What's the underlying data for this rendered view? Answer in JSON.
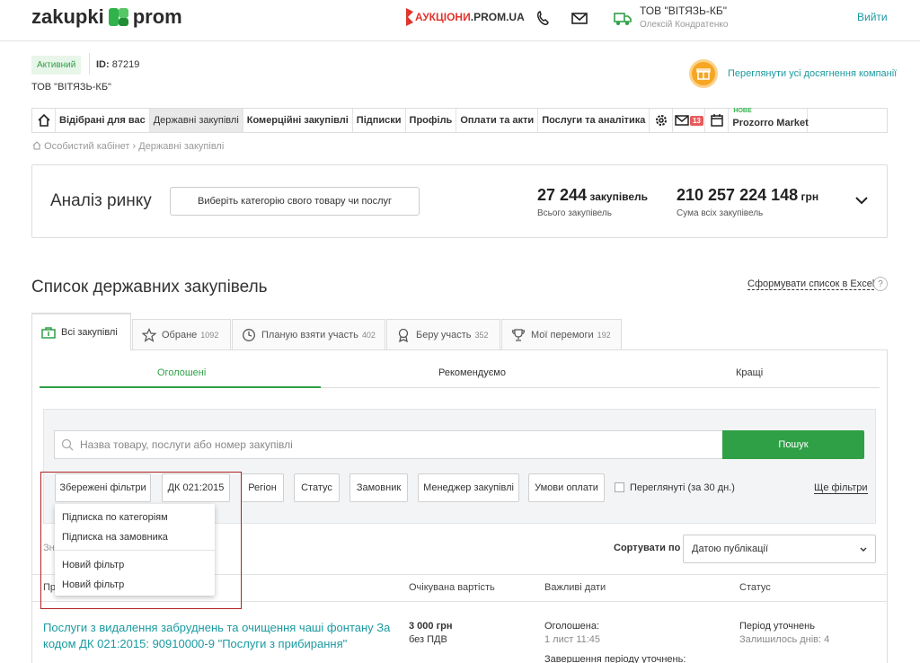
{
  "header": {
    "logo_left": "zakupki",
    "logo_right": "prom",
    "auctions_red": "АУКЦІОНИ",
    "auctions_black": ".PROM.UA",
    "company_name": "ТОВ \"ВІТЯЗЬ-КБ\"",
    "person_name": "Олексій Кондратенко",
    "logout": "Вийти"
  },
  "status": {
    "badge": "Активний",
    "id_label": "ID:",
    "id_value": "87219",
    "company": "ТОВ \"ВІТЯЗЬ-КБ\"",
    "achievements_link": "Переглянути усі досягнення компанії"
  },
  "nav": {
    "items": [
      "Відібрані для вас",
      "Державні закупівлі",
      "Комерційні закупівлі",
      "Підписки",
      "Профіль",
      "Оплати та акти",
      "Послуги та аналітика"
    ],
    "mail_count": "13",
    "market_new": "НОВЕ",
    "market": "Prozorro Market"
  },
  "breadcrumb": "Особистий кабінет › Державні закупівлі",
  "analysis": {
    "title": "Аналіз ринку",
    "select_button": "Виберіть категорію свого товару чи послуг",
    "total_count": "27 244",
    "total_unit": "закупівель",
    "total_label": "Всього закупівель",
    "sum_value": "210 257 224 148",
    "sum_unit": "грн",
    "sum_label": "Сума всіх закупівель"
  },
  "list": {
    "title": "Список державних закупівель",
    "excel_link": "Сформувати список в Excel",
    "help": "?"
  },
  "tabs": [
    {
      "label": "Всі закупівлі",
      "count": ""
    },
    {
      "label": "Обране",
      "count": "1092"
    },
    {
      "label": "Планую взяти участь",
      "count": "402"
    },
    {
      "label": "Беру участь",
      "count": "352"
    },
    {
      "label": "Мої перемоги",
      "count": "192"
    }
  ],
  "subtabs": [
    "Оголошені",
    "Рекомендуємо",
    "Кращі"
  ],
  "filters": {
    "search_placeholder": "Назва товару, послуги або номер закупівлі",
    "search_button": "Пошук",
    "chips": [
      "Збережені фільтри",
      "ДК 021:2015",
      "Регіон",
      "Статус",
      "Замовник",
      "Менеджер закупівлі",
      "Умови оплати"
    ],
    "viewed_label": "Переглянуті (за 30 дн.)",
    "more_filters": "Ще фільтри",
    "saved_dropdown": [
      "Підписка по категоріям",
      "Підписка на замовника",
      "Новий фільтр",
      "Новий фільтр"
    ]
  },
  "sort": {
    "label": "Сортувати по",
    "value": "Датою публікації",
    "partial_left": "Зн"
  },
  "table": {
    "headers": [
      "Пр",
      "Очікувана вартість",
      "Важливі дати",
      "Статус"
    ],
    "rows": [
      {
        "title": "Послуги з видалення забруднень та очищення чаші фонтану За кодом ДК 021:2015: 90910000-9 \"Послуги з прибирання\"",
        "price": "3 000 грн",
        "vat": "без ПДВ",
        "date_label": "Оголошена:",
        "date_value": "1 лист 11:45",
        "date_label2": "Завершення періоду уточнень:",
        "status": "Період уточнень",
        "status_sub": "Залишилось днів: 4"
      }
    ]
  },
  "colors": {
    "accent_green": "#2fa046",
    "link_teal": "#1a9aa0",
    "auction_red": "#e0342c",
    "highlight_red": "#b22222"
  }
}
